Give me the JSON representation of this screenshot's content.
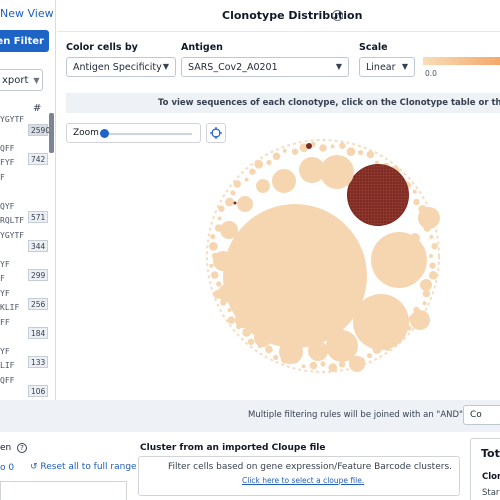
{
  "left_panel": {
    "new_view": "New View",
    "filter_button": "en Filter",
    "export_label": "xport",
    "count_header": "#",
    "rows": [
      {
        "line1": "YGYTF",
        "line2": "",
        "count": "2590"
      },
      {
        "line1": "QFF",
        "line2": "FYF",
        "count": "742"
      },
      {
        "line1": "F",
        "line2": "",
        "count": ""
      },
      {
        "line1": "QYF",
        "line2": "RQLTF",
        "count": "571"
      },
      {
        "line1": "YGYTF",
        "line2": "",
        "count": "344"
      },
      {
        "line1": "YF",
        "line2": "F",
        "count": "299"
      },
      {
        "line1": "YF",
        "line2": "KLIF",
        "count": "256"
      },
      {
        "line1": "FF",
        "line2": "",
        "count": "184"
      },
      {
        "line1": "YF",
        "line2": "LIF",
        "count": "133"
      },
      {
        "line1": "QFF",
        "line2": "",
        "count": "106"
      }
    ]
  },
  "header": {
    "title": "Clonotype Distribution",
    "help": "?"
  },
  "controls": {
    "color_label": "Color cells by",
    "color_value": "Antigen Specificity",
    "antigen_label": "Antigen",
    "antigen_value": "SARS_Cov2_A0201",
    "scale_label": "Scale",
    "scale_value": "Linear",
    "legend_min": "0.0"
  },
  "info_text": "To view sequences of each clonotype, click on the Clonotype table or the distribution",
  "zoom": {
    "label": "Zoom"
  },
  "footer": {
    "note": "Multiple filtering rules will be joined with an \"AND\"",
    "copy_button": "Co"
  },
  "bottom_left": {
    "title": "en",
    "help": "?",
    "count": "o 0",
    "reset": "Reset all to full range"
  },
  "cluster": {
    "title": "Cluster from an imported Cloupe file",
    "description": "Filter cells based on gene expression/Feature Barcode clusters.",
    "link": "Click here to select a cloupe file."
  },
  "totals": {
    "title": "Tota",
    "line1": "Clon",
    "line2": "Star"
  },
  "colors": {
    "accent": "#1e63c6",
    "bubble_light": "#f6d6b1",
    "bubble_dark": "#7b2b22"
  }
}
